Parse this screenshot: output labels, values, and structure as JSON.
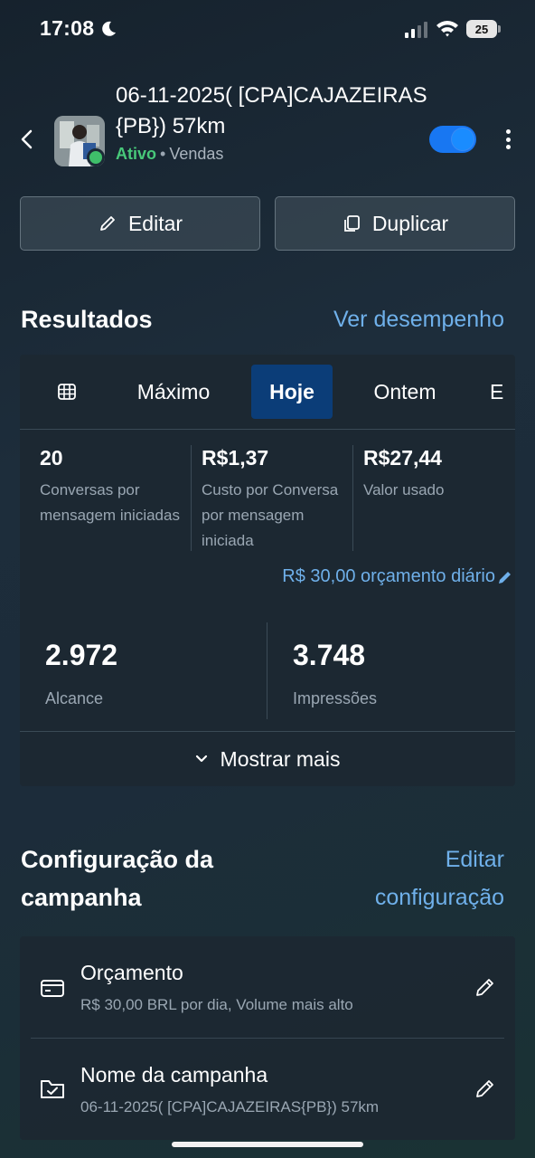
{
  "status_bar": {
    "time": "17:08",
    "battery": "25"
  },
  "header": {
    "title": "06-11-2025( [CPA]CAJAZEIRAS{PB}) 57km",
    "status": "Ativo",
    "separator": "•",
    "objective": "Vendas",
    "toggle_on": true
  },
  "actions": {
    "edit_label": "Editar",
    "duplicate_label": "Duplicar"
  },
  "results": {
    "title": "Resultados",
    "link": "Ver desempenho",
    "tabs": [
      {
        "label": "Máximo",
        "active": false
      },
      {
        "label": "Hoje",
        "active": true
      },
      {
        "label": "Ontem",
        "active": false
      },
      {
        "label": "E",
        "active": false
      }
    ],
    "metrics": [
      {
        "value": "20",
        "label": "Conversas por mensagem iniciadas"
      },
      {
        "value": "R$1,37",
        "label": "Custo por Conversa por mensagem iniciada"
      },
      {
        "value": "R$27,44",
        "label": "Valor usado"
      }
    ],
    "budget_text": "R$ 30,00 orçamento diário",
    "reach": {
      "value": "2.972",
      "label": "Alcance"
    },
    "impressions": {
      "value": "3.748",
      "label": "Impressões"
    },
    "show_more": "Mostrar mais"
  },
  "campaign_settings": {
    "title": "Configuração da campanha",
    "link": "Editar configuração",
    "rows": [
      {
        "title": "Orçamento",
        "subtitle": "R$ 30,00 BRL por dia, Volume mais alto",
        "icon": "credit-card-icon"
      },
      {
        "title": "Nome da campanha",
        "subtitle": "06-11-2025( [CPA]CAJAZEIRAS{PB}) 57km",
        "icon": "folder-check-icon"
      }
    ]
  },
  "colors": {
    "accent": "#6fb0ea",
    "active_tab": "#0b3d78",
    "status_green": "#48c97a",
    "toggle": "#1877f2"
  }
}
